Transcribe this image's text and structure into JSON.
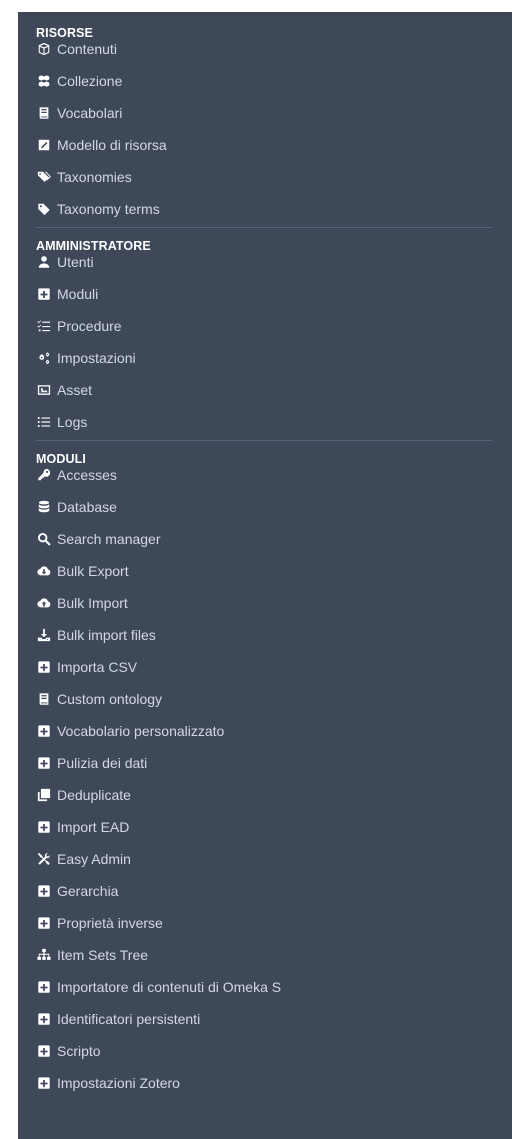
{
  "colors": {
    "background": "#3e4859",
    "text": "#d3d9e2",
    "heading": "#ffffff",
    "divider": "#58627a"
  },
  "sections": [
    {
      "title": "RISORSE",
      "items": [
        {
          "label": "Contenuti",
          "icon": "cube-icon"
        },
        {
          "label": "Collezione",
          "icon": "cubes-icon"
        },
        {
          "label": "Vocabolari",
          "icon": "book-icon"
        },
        {
          "label": "Modello di risorsa",
          "icon": "edit-square-icon"
        },
        {
          "label": "Taxonomies",
          "icon": "tags-icon"
        },
        {
          "label": "Taxonomy terms",
          "icon": "tag-icon"
        }
      ]
    },
    {
      "title": "AMMINISTRATORE",
      "items": [
        {
          "label": "Utenti",
          "icon": "user-icon"
        },
        {
          "label": "Moduli",
          "icon": "plus-square-icon"
        },
        {
          "label": "Procedure",
          "icon": "tasks-icon"
        },
        {
          "label": "Impostazioni",
          "icon": "cogs-icon"
        },
        {
          "label": "Asset",
          "icon": "image-icon"
        },
        {
          "label": "Logs",
          "icon": "list-icon"
        }
      ]
    },
    {
      "title": "MODULI",
      "items": [
        {
          "label": "Accesses",
          "icon": "key-icon"
        },
        {
          "label": "Database",
          "icon": "database-icon"
        },
        {
          "label": "Search manager",
          "icon": "search-icon"
        },
        {
          "label": "Bulk Export",
          "icon": "cloud-download-icon"
        },
        {
          "label": "Bulk Import",
          "icon": "cloud-upload-icon"
        },
        {
          "label": "Bulk import files",
          "icon": "download-icon"
        },
        {
          "label": "Importa CSV",
          "icon": "plus-square-icon"
        },
        {
          "label": "Custom ontology",
          "icon": "book-icon"
        },
        {
          "label": "Vocabolario personalizzato",
          "icon": "plus-square-icon"
        },
        {
          "label": "Pulizia dei dati",
          "icon": "plus-square-icon"
        },
        {
          "label": "Deduplicate",
          "icon": "clone-icon"
        },
        {
          "label": "Import EAD",
          "icon": "plus-square-icon"
        },
        {
          "label": "Easy Admin",
          "icon": "tools-icon"
        },
        {
          "label": "Gerarchia",
          "icon": "plus-square-icon"
        },
        {
          "label": "Proprietà inverse",
          "icon": "plus-square-icon"
        },
        {
          "label": "Item Sets Tree",
          "icon": "sitemap-icon"
        },
        {
          "label": "Importatore di contenuti di Omeka S",
          "icon": "plus-square-icon"
        },
        {
          "label": "Identificatori persistenti",
          "icon": "plus-square-icon"
        },
        {
          "label": "Scripto",
          "icon": "plus-square-icon"
        },
        {
          "label": "Impostazioni Zotero",
          "icon": "plus-square-icon"
        }
      ]
    }
  ]
}
